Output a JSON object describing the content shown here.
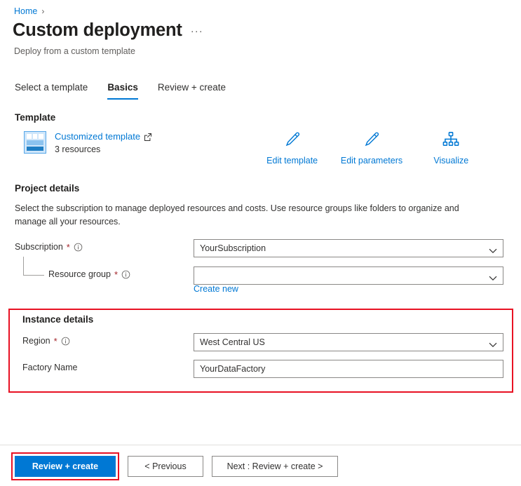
{
  "breadcrumb": {
    "home_label": "Home",
    "separator": "›"
  },
  "header": {
    "title": "Custom deployment",
    "subtitle": "Deploy from a custom template",
    "more_label": "···"
  },
  "tabs": [
    {
      "label": "Select a template",
      "active": false
    },
    {
      "label": "Basics",
      "active": true
    },
    {
      "label": "Review + create",
      "active": false
    }
  ],
  "template": {
    "heading": "Template",
    "link_label": "Customized template",
    "resource_count": "3 resources",
    "actions": [
      {
        "label": "Edit template",
        "icon": "pencil-icon"
      },
      {
        "label": "Edit parameters",
        "icon": "pencil-icon"
      },
      {
        "label": "Visualize",
        "icon": "hierarchy-icon"
      }
    ]
  },
  "project_details": {
    "heading": "Project details",
    "description": "Select the subscription to manage deployed resources and costs. Use resource groups like folders to organize and manage all your resources.",
    "subscription": {
      "label": "Subscription",
      "required_marker": "*",
      "value": "YourSubscription"
    },
    "resource_group": {
      "label": "Resource group",
      "required_marker": "*",
      "value": "",
      "placeholder": "",
      "create_new_label": "Create new"
    }
  },
  "instance_details": {
    "heading": "Instance details",
    "region": {
      "label": "Region",
      "required_marker": "*",
      "value": "West Central US"
    },
    "factory_name": {
      "label": "Factory Name",
      "value": "YourDataFactory"
    }
  },
  "footer": {
    "review_create_label": "Review + create",
    "previous_label": "< Previous",
    "next_label": "Next : Review + create >"
  },
  "colors": {
    "accent": "#0078d4",
    "highlight": "#e81123",
    "required": "#a4262c",
    "text": "#323130",
    "muted": "#605e5c"
  }
}
